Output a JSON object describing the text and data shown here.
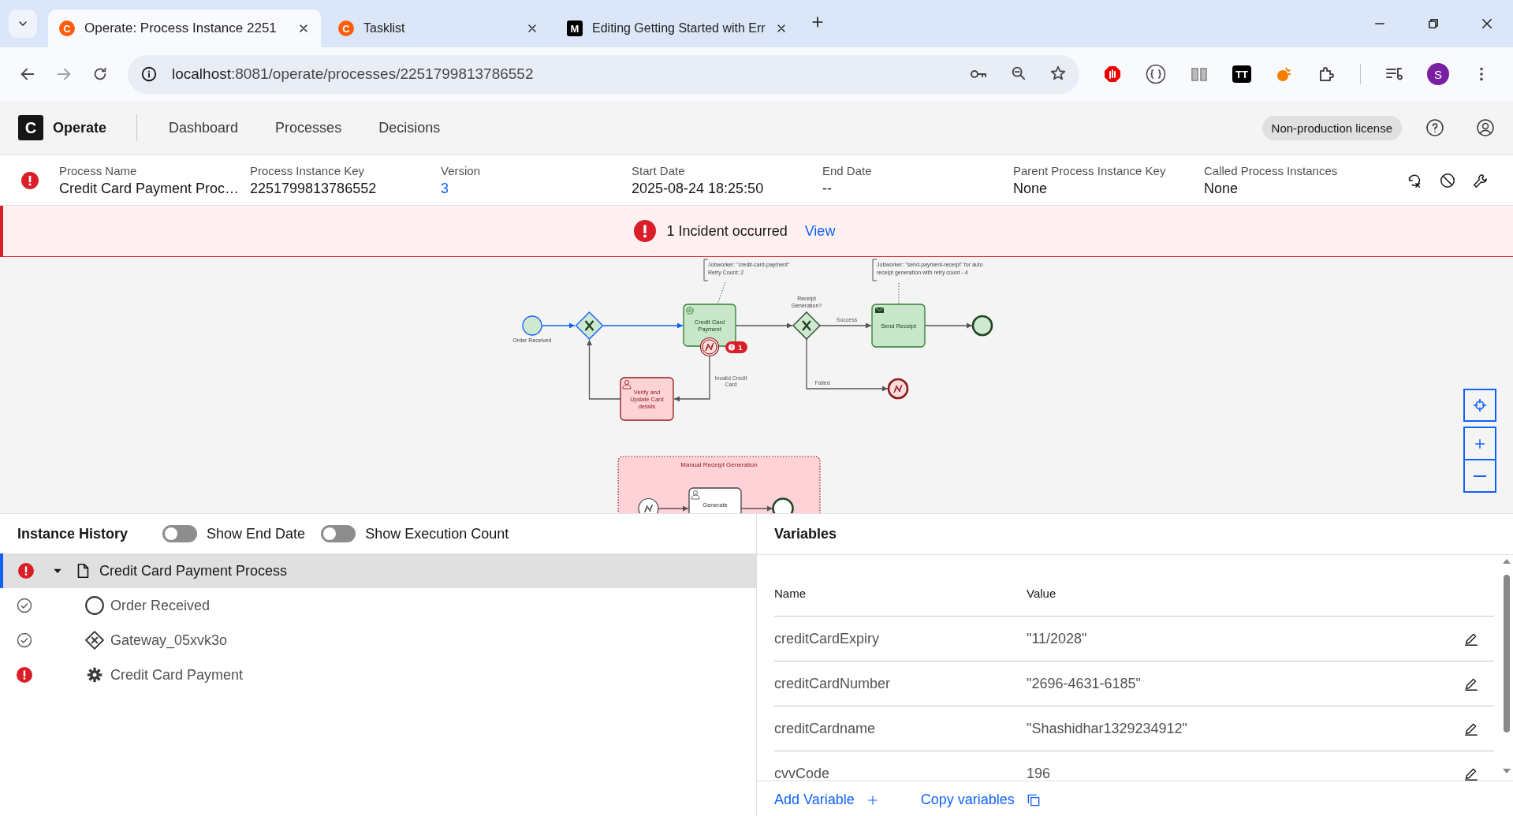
{
  "browser": {
    "tabs": [
      {
        "title": "Operate: Process Instance 2251",
        "selected": true,
        "favicon": "C",
        "color": "#fc5d0d"
      },
      {
        "title": "Tasklist",
        "selected": false,
        "favicon": "C",
        "color": "#fc5d0d"
      },
      {
        "title": "Editing Getting Started with Err",
        "selected": false,
        "favicon": "M",
        "color": "#000000"
      }
    ],
    "url_host": "localhost",
    "url_path": ":8081/operate/processes/2251799813786552",
    "extension_badge": "TT",
    "profile_initial": "S"
  },
  "app": {
    "logo": "C",
    "name": "Operate",
    "nav": [
      {
        "label": "Dashboard"
      },
      {
        "label": "Processes"
      },
      {
        "label": "Decisions"
      }
    ],
    "license": "Non-production license"
  },
  "instance": {
    "incident": true,
    "fields": [
      {
        "label": "Process Name",
        "value": "Credit Card Payment Proc…",
        "kind": "text"
      },
      {
        "label": "Process Instance Key",
        "value": "2251799813786552",
        "kind": "text"
      },
      {
        "label": "Version",
        "value": "3",
        "kind": "link"
      },
      {
        "label": "Start Date",
        "value": "2025-08-24 18:25:50",
        "kind": "text"
      },
      {
        "label": "End Date",
        "value": "--",
        "kind": "text"
      },
      {
        "label": "Parent Process Instance Key",
        "value": "None",
        "kind": "text"
      },
      {
        "label": "Called Process Instances",
        "value": "None",
        "kind": "text"
      }
    ]
  },
  "banner": {
    "message": "1 Incident occurred",
    "link": "View"
  },
  "diagram": {
    "nodes": [
      {
        "kind": "start-event",
        "label": [
          "Order Received"
        ],
        "color": "#cfe8d0"
      },
      {
        "kind": "gateway",
        "color": "#cfe8d0"
      },
      {
        "kind": "service-task",
        "label": [
          "Credit Card",
          "Payment"
        ],
        "color": "#c8e6c9",
        "incidents": "1"
      },
      {
        "kind": "boundary-error",
        "color": "#fcdcdc"
      },
      {
        "kind": "gateway",
        "label": [
          "Receipt",
          "Generation?"
        ],
        "color": "#cfe8d0"
      },
      {
        "kind": "send-task",
        "label": [
          "Send Receipt"
        ],
        "color": "#c8e6c9"
      },
      {
        "kind": "end-event",
        "color": "#cfe8d0"
      },
      {
        "kind": "error-end",
        "color": "#fcdcdc"
      },
      {
        "kind": "user-task",
        "label": [
          "Verify and",
          "Update Card",
          "details"
        ],
        "color": "#fdd3d6"
      },
      {
        "kind": "subprocess",
        "label": [
          "Manual Receipt Generation"
        ],
        "color": "#ffd2d8"
      },
      {
        "kind": "error-start",
        "color": "#ffffff"
      },
      {
        "kind": "user-task",
        "label": [
          "Generate"
        ],
        "color": "#ffffff"
      },
      {
        "kind": "end-event",
        "color": "#ffffff"
      }
    ],
    "flows": [
      {
        "taken": true
      },
      {
        "taken": true
      },
      {
        "taken": false
      },
      {
        "taken": false,
        "label": [
          "Success"
        ]
      },
      {
        "taken": false
      },
      {
        "taken": false,
        "label": [
          "Failed"
        ]
      },
      {
        "taken": false,
        "label": [
          "Invalid Credit",
          "Card"
        ]
      },
      {
        "taken": false
      },
      {
        "taken": false
      },
      {
        "taken": false
      }
    ],
    "annotations": [
      [
        "Jobworker: \"credit-card-payment\"",
        "Retry Count: 2"
      ],
      [
        "Jobworker: \"send-payment-receipt\" for auto",
        "receipt generation with retry count - 4"
      ]
    ]
  },
  "history": {
    "title": "Instance History",
    "toggles": [
      {
        "label": "Show End Date",
        "on": false
      },
      {
        "label": "Show Execution Count",
        "on": false
      }
    ],
    "tree": {
      "label": "Credit Card Payment Process",
      "kind": "process",
      "incident": true,
      "expanded": true,
      "selected": true,
      "children": [
        {
          "label": "Order Received",
          "kind": "start-event",
          "incident": false,
          "selected": false
        },
        {
          "label": "Gateway_05xvk3o",
          "kind": "gateway",
          "incident": false,
          "selected": false
        },
        {
          "label": "Credit Card Payment",
          "kind": "service-task",
          "incident": true,
          "selected": false
        }
      ]
    }
  },
  "variables": {
    "title": "Variables",
    "columns": [
      "Name",
      "Value"
    ],
    "rows": [
      {
        "name": "creditCardExpiry",
        "value": "\"11/2028\""
      },
      {
        "name": "creditCardNumber",
        "value": "\"2696-4631-6185\""
      },
      {
        "name": "creditCardname",
        "value": "\"Shashidhar1329234912\""
      },
      {
        "name": "cvvCode",
        "value": "196"
      }
    ],
    "add_link": "Add Variable",
    "copy_link": "Copy variables"
  }
}
